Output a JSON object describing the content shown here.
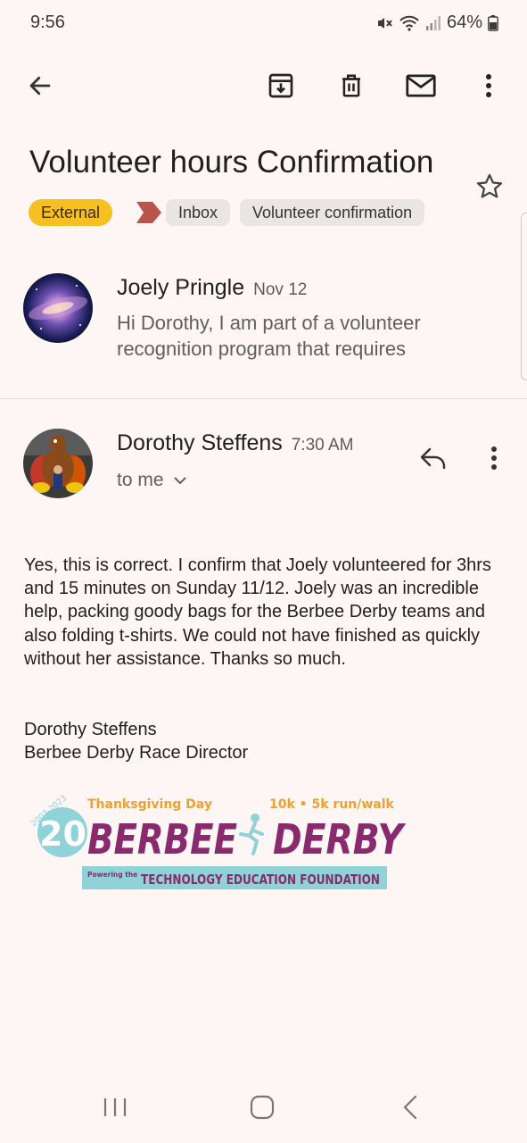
{
  "status_bar": {
    "time": "9:56",
    "battery": "64%"
  },
  "toolbar": {
    "back_icon": "arrow-left-icon",
    "archive_icon": "archive-icon",
    "delete_icon": "trash-icon",
    "unread_icon": "mail-icon",
    "more_icon": "more-vert-icon"
  },
  "email": {
    "subject": "Volunteer hours Confirmation",
    "labels": {
      "external": "External",
      "inbox": "Inbox",
      "category": "Volunteer confirmation"
    }
  },
  "messages": [
    {
      "sender": "Joely Pringle",
      "date": "Nov 12",
      "snippet": "Hi Dorothy, I am part of a volunteer recognition program that requires"
    },
    {
      "sender": "Dorothy Steffens",
      "time": "7:30 AM",
      "recipient": "to me",
      "body": "Yes, this is correct. I confirm that Joely volunteered for 3hrs and 15 minutes on Sunday 11/12.  Joely was an incredible help, packing goody bags for the Berbee Derby teams and also folding t-shirts.  We could not have finished as quickly without her assistance. Thanks so much.",
      "signature_name": "Dorothy Steffens",
      "signature_title": "Berbee Derby Race Director"
    }
  ],
  "logo": {
    "years": "2003-2023",
    "number": "20",
    "day": "Thanksgiving Day",
    "race": "10k • 5k run/walk",
    "name_left": "BERBEE",
    "name_right": "DERBY",
    "powering": "Powering the",
    "foundation": "TECHNOLOGY EDUCATION FOUNDATION"
  },
  "colors": {
    "accent_label": "#f6c023",
    "logo_purple": "#8a2a6e",
    "logo_teal": "#8fd2d8",
    "logo_orange": "#f0a030"
  }
}
